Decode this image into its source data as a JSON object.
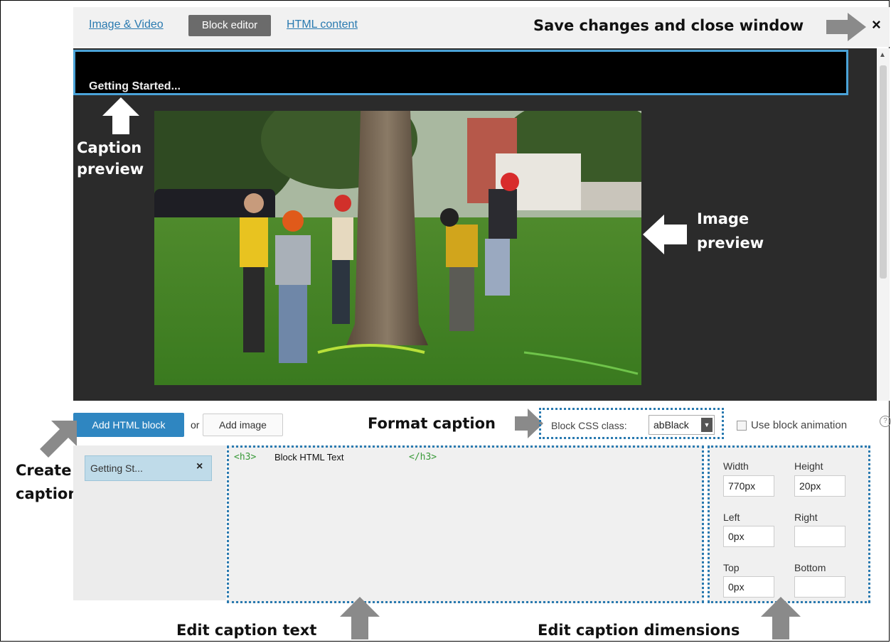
{
  "tabs": {
    "image_video": "Image & Video",
    "block_editor": "Block editor",
    "html_content": "HTML content"
  },
  "close_label": "×",
  "preview": {
    "caption_text": "Getting Started..."
  },
  "toolbar": {
    "add_html_block": "Add HTML block",
    "or": "or",
    "add_image": "Add image",
    "css_class_label": "Block CSS class:",
    "css_class_value": "abBlack",
    "use_animation": "Use block animation",
    "help": "?"
  },
  "blocks": [
    {
      "label": "Getting St...",
      "remove": "×"
    }
  ],
  "editor": {
    "open_tag": "<h3>",
    "text": "Block HTML Text",
    "close_tag": "</h3>"
  },
  "dimensions": {
    "width_label": "Width",
    "width_value": "770px",
    "height_label": "Height",
    "height_value": "20px",
    "left_label": "Left",
    "left_value": "0px",
    "right_label": "Right",
    "right_value": "",
    "top_label": "Top",
    "top_value": "0px",
    "bottom_label": "Bottom",
    "bottom_value": ""
  },
  "annotations": {
    "save_close": "Save changes and close window",
    "caption_preview_1": "Caption",
    "caption_preview_2": "preview",
    "image_preview_1": "Image",
    "image_preview_2": "preview",
    "format_caption": "Format caption",
    "create_caption_1": "Create",
    "create_caption_2": "caption",
    "edit_text": "Edit caption text",
    "edit_dims": "Edit caption  dimensions"
  },
  "colors": {
    "accent": "#2f86c1",
    "caption_border": "#4aa3d8",
    "tab_active_bg": "#6b6b6b",
    "annotation_arrow": "#8a8a8a"
  }
}
